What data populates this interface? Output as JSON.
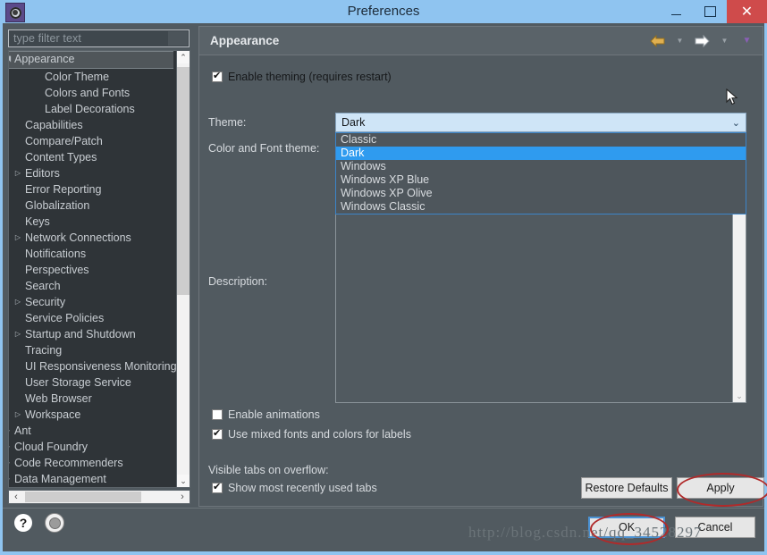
{
  "window": {
    "title": "Preferences",
    "icon": "gear-icon",
    "controls": {
      "minimize": "–",
      "maximize": "▢",
      "close": "✕"
    },
    "accent_blue": "#8fc4f0",
    "close_red": "#cf4b4b"
  },
  "sidebar": {
    "filter": {
      "placeholder": "type filter text",
      "value": ""
    },
    "items": [
      {
        "label": "Appearance",
        "indent": 0,
        "twisty": "expanded",
        "selected": true
      },
      {
        "label": "Color Theme",
        "indent": 2,
        "twisty": "none",
        "selected": false
      },
      {
        "label": "Colors and Fonts",
        "indent": 2,
        "twisty": "none",
        "selected": false
      },
      {
        "label": "Label Decorations",
        "indent": 2,
        "twisty": "none",
        "selected": false
      },
      {
        "label": "Capabilities",
        "indent": 1,
        "twisty": "none",
        "selected": false
      },
      {
        "label": "Compare/Patch",
        "indent": 1,
        "twisty": "none",
        "selected": false
      },
      {
        "label": "Content Types",
        "indent": 1,
        "twisty": "none",
        "selected": false
      },
      {
        "label": "Editors",
        "indent": 1,
        "twisty": "collapsed",
        "selected": false
      },
      {
        "label": "Error Reporting",
        "indent": 1,
        "twisty": "none",
        "selected": false
      },
      {
        "label": "Globalization",
        "indent": 1,
        "twisty": "none",
        "selected": false
      },
      {
        "label": "Keys",
        "indent": 1,
        "twisty": "none",
        "selected": false
      },
      {
        "label": "Network Connections",
        "indent": 1,
        "twisty": "collapsed",
        "selected": false
      },
      {
        "label": "Notifications",
        "indent": 1,
        "twisty": "none",
        "selected": false
      },
      {
        "label": "Perspectives",
        "indent": 1,
        "twisty": "none",
        "selected": false
      },
      {
        "label": "Search",
        "indent": 1,
        "twisty": "none",
        "selected": false
      },
      {
        "label": "Security",
        "indent": 1,
        "twisty": "collapsed",
        "selected": false
      },
      {
        "label": "Service Policies",
        "indent": 1,
        "twisty": "none",
        "selected": false
      },
      {
        "label": "Startup and Shutdown",
        "indent": 1,
        "twisty": "collapsed",
        "selected": false
      },
      {
        "label": "Tracing",
        "indent": 1,
        "twisty": "none",
        "selected": false
      },
      {
        "label": "UI Responsiveness Monitoring",
        "indent": 1,
        "twisty": "none",
        "selected": false
      },
      {
        "label": "User Storage Service",
        "indent": 1,
        "twisty": "none",
        "selected": false
      },
      {
        "label": "Web Browser",
        "indent": 1,
        "twisty": "none",
        "selected": false
      },
      {
        "label": "Workspace",
        "indent": 1,
        "twisty": "collapsed",
        "selected": false
      },
      {
        "label": "Ant",
        "indent": 0,
        "twisty": "collapsed",
        "selected": false
      },
      {
        "label": "Cloud Foundry",
        "indent": 0,
        "twisty": "collapsed",
        "selected": false
      },
      {
        "label": "Code Recommenders",
        "indent": 0,
        "twisty": "collapsed",
        "selected": false
      },
      {
        "label": "Data Management",
        "indent": 0,
        "twisty": "collapsed",
        "selected": false
      }
    ],
    "help_icon": "?",
    "circle_icon": "circle-icon"
  },
  "pane": {
    "title": "Appearance",
    "nav": {
      "back_icon": "back-arrow-icon",
      "back_menu_icon": "chevron-down-icon",
      "forward_icon": "forward-arrow-icon",
      "forward_menu_icon": "chevron-down-icon",
      "view_menu_icon": "chevron-down-icon"
    },
    "enable_theming": {
      "label": "Enable theming (requires restart)",
      "checked": true
    },
    "theme_label": "Theme:",
    "theme_combo": {
      "value": "Dark",
      "caret": "⌄",
      "expanded": true,
      "options": [
        "Classic",
        "Dark",
        "Windows",
        "Windows XP Blue",
        "Windows XP Olive",
        "Windows Classic"
      ],
      "selected_index": 1
    },
    "color_font_theme_label": "Color and Font theme:",
    "description_label": "Description:",
    "description_value": "",
    "enable_animations": {
      "label": "Enable animations",
      "checked": false
    },
    "mixed_fonts": {
      "label": "Use mixed fonts and colors for labels",
      "checked": true
    },
    "visible_tabs_label": "Visible tabs on overflow:",
    "show_mru_tabs": {
      "label": "Show most recently used tabs",
      "checked": true
    }
  },
  "buttons": {
    "restore_defaults": "Restore Defaults",
    "apply": "Apply",
    "ok": "OK",
    "cancel": "Cancel"
  },
  "annotations": {
    "highlight_color": "#b02a2a",
    "watermark": "http://blog.csdn.net/qq_34528297"
  }
}
